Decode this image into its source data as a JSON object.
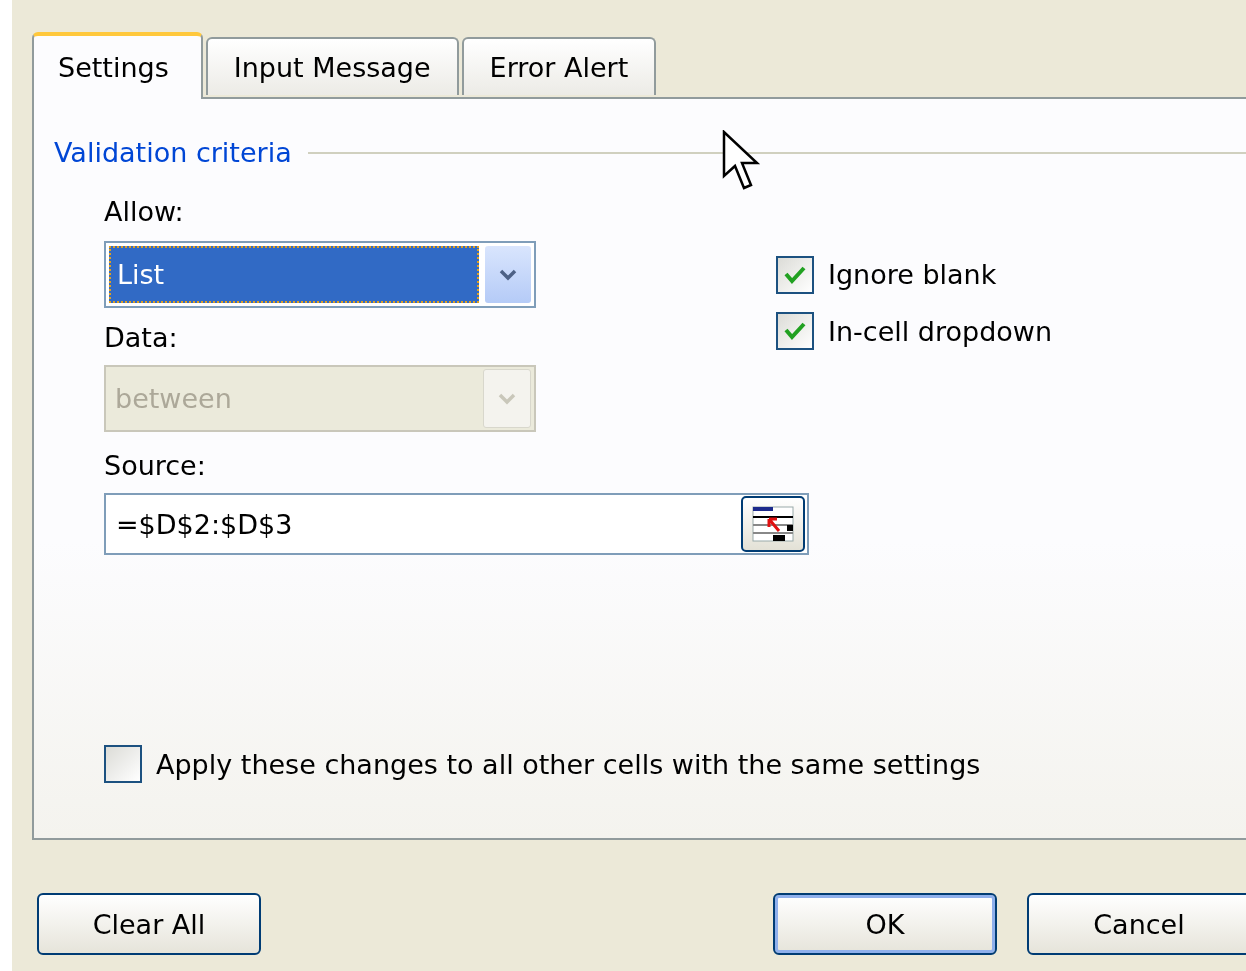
{
  "tabs": [
    {
      "label": "Settings",
      "selected": true
    },
    {
      "label": "Input Message",
      "selected": false
    },
    {
      "label": "Error Alert",
      "selected": false
    }
  ],
  "validation_criteria": {
    "title": "Validation criteria",
    "allow": {
      "label": "Allow:",
      "value": "List",
      "disabled": false
    },
    "data": {
      "label": "Data:",
      "value": "between",
      "disabled": true
    },
    "source": {
      "label": "Source:",
      "value": "=$D$2:$D$3"
    },
    "options": [
      {
        "label": "Ignore blank",
        "checked": true
      },
      {
        "label": "In-cell dropdown",
        "checked": true
      }
    ]
  },
  "apply_all": {
    "label": "Apply these changes to all other cells with the same settings",
    "checked": false
  },
  "buttons": [
    {
      "label": "Clear All",
      "kind": "normal"
    },
    {
      "label": "OK",
      "kind": "default"
    },
    {
      "label": "Cancel",
      "kind": "normal"
    }
  ]
}
